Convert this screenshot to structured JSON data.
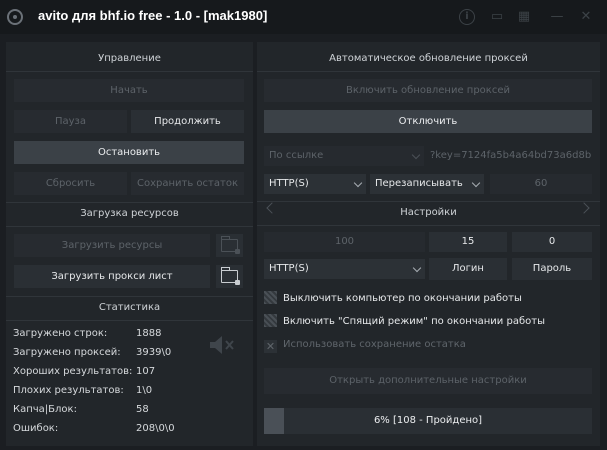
{
  "window": {
    "title": "avito для  bhf.io free  - 1.0 - [mak1980]",
    "icons": [
      "info-icon",
      "folder-icon",
      "calendar-icon",
      "minimize-icon",
      "close-icon"
    ]
  },
  "control": {
    "header": "Управление",
    "start": "Начать",
    "pause": "Пауза",
    "continue": "Продолжить",
    "stop": "Остановить",
    "reset": "Сбросить",
    "save_rest": "Сохранить остаток"
  },
  "resources": {
    "header": "Загрузка ресурсов",
    "load_resources": "Загрузить ресурсы",
    "load_proxy": "Загрузить прокси лист"
  },
  "stats": {
    "header": "Статистика",
    "rows": [
      {
        "label": "Загружено строк:",
        "value": "1888"
      },
      {
        "label": "Загружено проксей:",
        "value": "3939\\0"
      },
      {
        "label": "Хороших результатов:",
        "value": "107"
      },
      {
        "label": "Плохих результатов:",
        "value": "1\\0"
      },
      {
        "label": "Капча|Блок:",
        "value": "58"
      },
      {
        "label": "Ошибок:",
        "value": "208\\0\\0"
      }
    ]
  },
  "proxy_update": {
    "header": "Автоматическое обновление проксей",
    "enable": "Включить обновление проксей",
    "disable": "Отключить",
    "source_select": "По ссылке",
    "url_value": "?key=7124fa5b4a64bd73a6d8b",
    "type_select": "HTTP(S)",
    "mode_select": "Перезаписывать",
    "interval": "60"
  },
  "settings": {
    "header": "Настройки",
    "threads": "100",
    "value_a": "15",
    "value_b": "0",
    "proxy_type": "HTTP(S)",
    "login": "Логин",
    "password": "Пароль",
    "options": [
      {
        "label": "Выключить компьютер по окончании работы",
        "enabled": true,
        "checked": false
      },
      {
        "label": "Включить \"Спящий режим\" по окончании работы",
        "enabled": true,
        "checked": false
      },
      {
        "label": "Использовать сохранение остатка",
        "enabled": false,
        "checked": true
      }
    ],
    "open_more": "Открыть дополнительные настройки"
  },
  "progress": {
    "text": "6% [108 - Пройдено]",
    "fraction": 0.06
  },
  "colors": {
    "background": "#1b1e22",
    "panel": "#22262a",
    "button": "#2a2f34",
    "button_active": "#3b4147",
    "text": "#d6d9dc",
    "text_disabled": "#5d6369"
  }
}
